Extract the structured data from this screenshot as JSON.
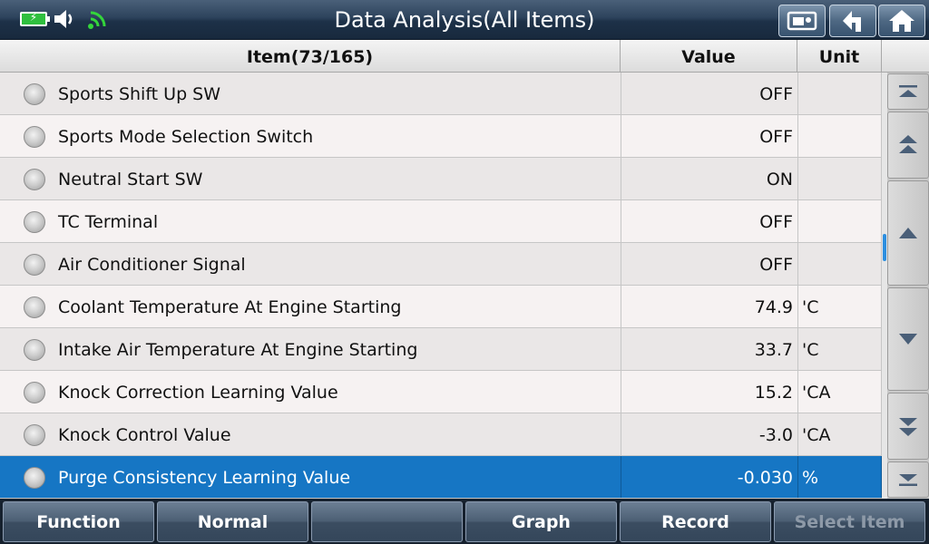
{
  "window": {
    "title": "Data Analysis(All Items)"
  },
  "status": {
    "battery_icon": "battery-charging-icon",
    "volume_icon": "volume-icon",
    "wifi_icon": "wifi-icon",
    "battery_color": "#2fbf3e",
    "wifi_color": "#34d53b"
  },
  "title_buttons": [
    {
      "icon": "screenshot-camera-icon"
    },
    {
      "icon": "back-arrow-icon"
    },
    {
      "icon": "home-icon"
    }
  ],
  "table": {
    "headers": {
      "item": "Item(73/165)",
      "value": "Value",
      "unit": "Unit"
    },
    "rows": [
      {
        "name": "Sports Shift Up SW",
        "value": "OFF",
        "unit": ""
      },
      {
        "name": "Sports Mode Selection Switch",
        "value": "OFF",
        "unit": ""
      },
      {
        "name": "Neutral Start SW",
        "value": "ON",
        "unit": ""
      },
      {
        "name": "TC Terminal",
        "value": "OFF",
        "unit": ""
      },
      {
        "name": "Air Conditioner Signal",
        "value": "OFF",
        "unit": ""
      },
      {
        "name": "Coolant Temperature At Engine Starting",
        "value": "74.9",
        "unit": "'C"
      },
      {
        "name": "Intake Air Temperature At Engine Starting",
        "value": "33.7",
        "unit": "'C"
      },
      {
        "name": "Knock Correction Learning Value",
        "value": "15.2",
        "unit": "'CA"
      },
      {
        "name": "Knock Control Value",
        "value": "-3.0",
        "unit": "'CA"
      },
      {
        "name": "Purge Consistency Learning Value",
        "value": "-0.030",
        "unit": "%",
        "selected": true
      }
    ]
  },
  "scroll_buttons": [
    {
      "icon": "scroll-top-icon"
    },
    {
      "icon": "page-up-icon"
    },
    {
      "icon": "scroll-up-icon"
    },
    {
      "icon": "scroll-down-icon"
    },
    {
      "icon": "page-down-icon"
    },
    {
      "icon": "scroll-bottom-icon"
    }
  ],
  "function_bar": {
    "buttons": [
      {
        "label": "Function",
        "enabled": true
      },
      {
        "label": "Normal",
        "enabled": true
      },
      {
        "label": "",
        "enabled": true
      },
      {
        "label": "Graph",
        "enabled": true
      },
      {
        "label": "Record",
        "enabled": true
      },
      {
        "label": "Select Item",
        "enabled": false
      }
    ]
  },
  "colors": {
    "selected_row": "#1676c4",
    "title_bar": "#2d435c"
  }
}
